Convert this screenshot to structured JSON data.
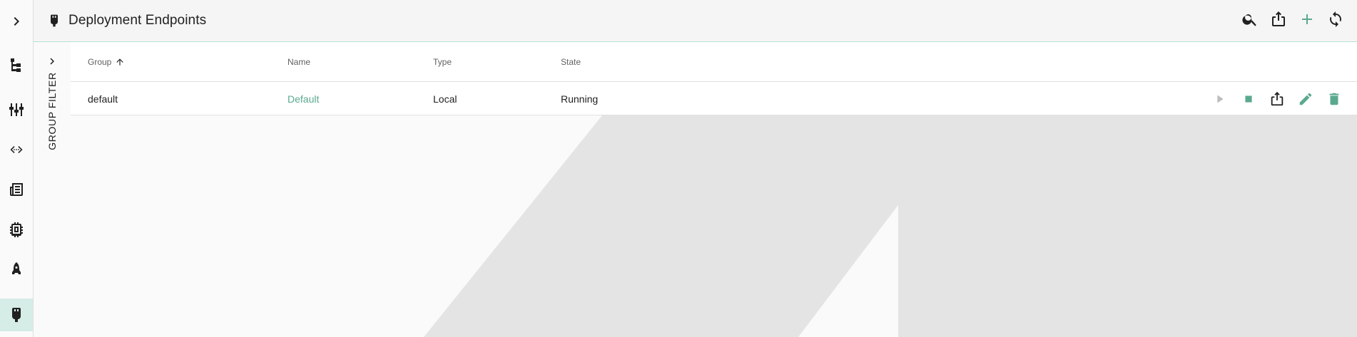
{
  "header": {
    "title": "Deployment Endpoints",
    "title_icon": "plug-icon",
    "actions": [
      {
        "name": "search-icon"
      },
      {
        "name": "export-icon"
      },
      {
        "name": "add-icon"
      },
      {
        "name": "refresh-icon"
      }
    ]
  },
  "rail": {
    "items": [
      {
        "icon": "chevron-right-icon"
      },
      {
        "icon": "hierarchy-icon"
      },
      {
        "icon": "mixer-icon"
      },
      {
        "icon": "code-icon"
      },
      {
        "icon": "newspaper-icon"
      },
      {
        "icon": "chip-icon"
      },
      {
        "icon": "rocket-icon"
      },
      {
        "icon": "plug-icon",
        "active": true
      }
    ]
  },
  "group_filter": {
    "label": "GROUP FILTER"
  },
  "table": {
    "columns": [
      "Group",
      "Name",
      "Type",
      "State"
    ],
    "sort": {
      "column": "Group",
      "direction": "ascending"
    },
    "rows": [
      {
        "group": "default",
        "name": "Default",
        "type": "Local",
        "state": "Running"
      }
    ]
  },
  "colors": {
    "accent": "#5aa98f",
    "active_rail_bg": "#d6ece6",
    "header_bg": "#f5f5f5",
    "disabled": "#bdbdbd"
  }
}
